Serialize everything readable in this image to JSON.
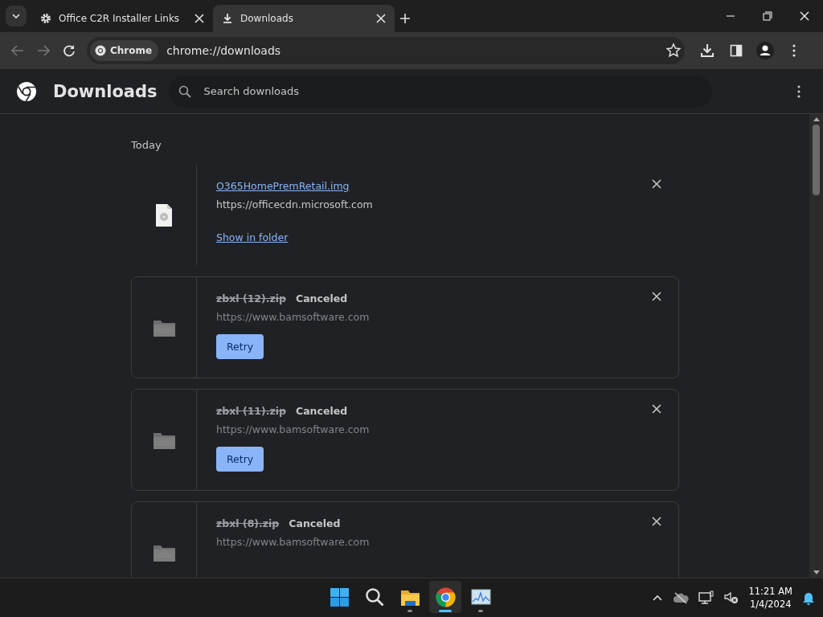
{
  "tabs": [
    {
      "title": "Office C2R Installer Links",
      "kind": "gear",
      "selected": false
    },
    {
      "title": "Downloads",
      "kind": "download",
      "selected": true
    }
  ],
  "address_bar": {
    "chip": "Chrome",
    "url": "chrome://downloads"
  },
  "page": {
    "title": "Downloads",
    "search": {
      "placeholder": "Search downloads"
    }
  },
  "date_group": "Today",
  "downloads": [
    {
      "kind": "complete",
      "name": "O365HomePremRetail.img",
      "source": "https://officecdn.microsoft.com",
      "action": "Show in folder"
    },
    {
      "kind": "canceled",
      "name": "zbxl (12).zip",
      "status": "Canceled",
      "source": "https://www.bamsoftware.com",
      "action": "Retry"
    },
    {
      "kind": "canceled",
      "name": "zbxl (11).zip",
      "status": "Canceled",
      "source": "https://www.bamsoftware.com",
      "action": "Retry"
    },
    {
      "kind": "canceled",
      "name": "zbxl (8).zip",
      "status": "Canceled",
      "source": "https://www.bamsoftware.com"
    }
  ],
  "taskbar": {
    "apps": [
      {
        "kind": "start",
        "running": false,
        "selected": false
      },
      {
        "kind": "search",
        "running": false,
        "selected": false
      },
      {
        "kind": "folder",
        "running": true,
        "selected": false
      },
      {
        "kind": "chrome",
        "running": true,
        "selected": true
      },
      {
        "kind": "monitor",
        "running": true,
        "selected": false
      }
    ],
    "time": "11:21 AM",
    "date": "1/4/2024"
  }
}
